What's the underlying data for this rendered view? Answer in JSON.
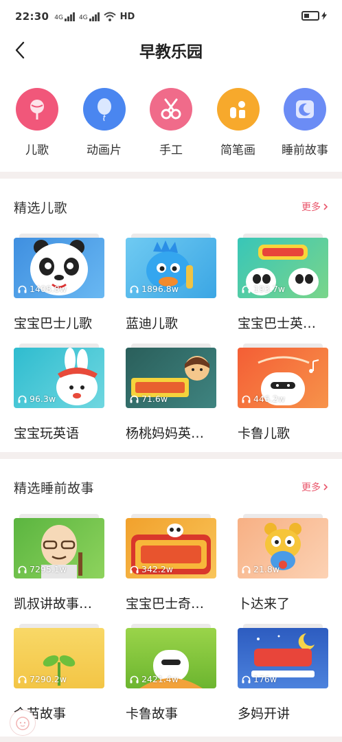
{
  "status": {
    "time": "22:30",
    "net1": "4G",
    "net2": "4G",
    "wifi": "HD"
  },
  "header": {
    "title": "早教乐园"
  },
  "categories": [
    {
      "label": "儿歌",
      "icon": "lollipop-icon",
      "color": "#f1577a"
    },
    {
      "label": "动画片",
      "icon": "balloon-icon",
      "color": "#4a86f0"
    },
    {
      "label": "手工",
      "icon": "scissors-icon",
      "color": "#f06b8a"
    },
    {
      "label": "简笔画",
      "icon": "drawing-icon",
      "color": "#f7a92c"
    },
    {
      "label": "睡前故事",
      "icon": "moon-icon",
      "color": "#6b8cf5"
    }
  ],
  "songs": {
    "title": "精选儿歌",
    "more": "更多",
    "items": [
      {
        "name": "宝宝巴士儿歌",
        "plays": "1408.8w",
        "bg": "#4a9fe6"
      },
      {
        "name": "蓝迪儿歌",
        "plays": "1896.8w",
        "bg": "#4bb3ec"
      },
      {
        "name": "宝宝巴士英…",
        "plays": "193.7w",
        "bg": "#3ec1b3"
      },
      {
        "name": "宝宝玩英语",
        "plays": "96.3w",
        "bg": "#34c3d5"
      },
      {
        "name": "杨桃妈妈英…",
        "plays": "71.6w",
        "bg": "#2f6e6a"
      },
      {
        "name": "卡鲁儿歌",
        "plays": "446.2w",
        "bg": "#f26a3b"
      }
    ]
  },
  "stories": {
    "title": "精选睡前故事",
    "more": "更多",
    "items": [
      {
        "name": "凯叔讲故事…",
        "plays": "7295.1w",
        "bg": "#6cc14c"
      },
      {
        "name": "宝宝巴士奇…",
        "plays": "342.2w",
        "bg": "#f5a630"
      },
      {
        "name": "卜达来了",
        "plays": "21.8w",
        "bg": "#f6b38a"
      },
      {
        "name": "金苗故事",
        "plays": "7290.2w",
        "bg": "#f6d66b"
      },
      {
        "name": "卡鲁故事",
        "plays": "2421.4w",
        "bg": "#86c63a"
      },
      {
        "name": "多妈开讲",
        "plays": "176w",
        "bg": "#3b68c7"
      }
    ]
  }
}
